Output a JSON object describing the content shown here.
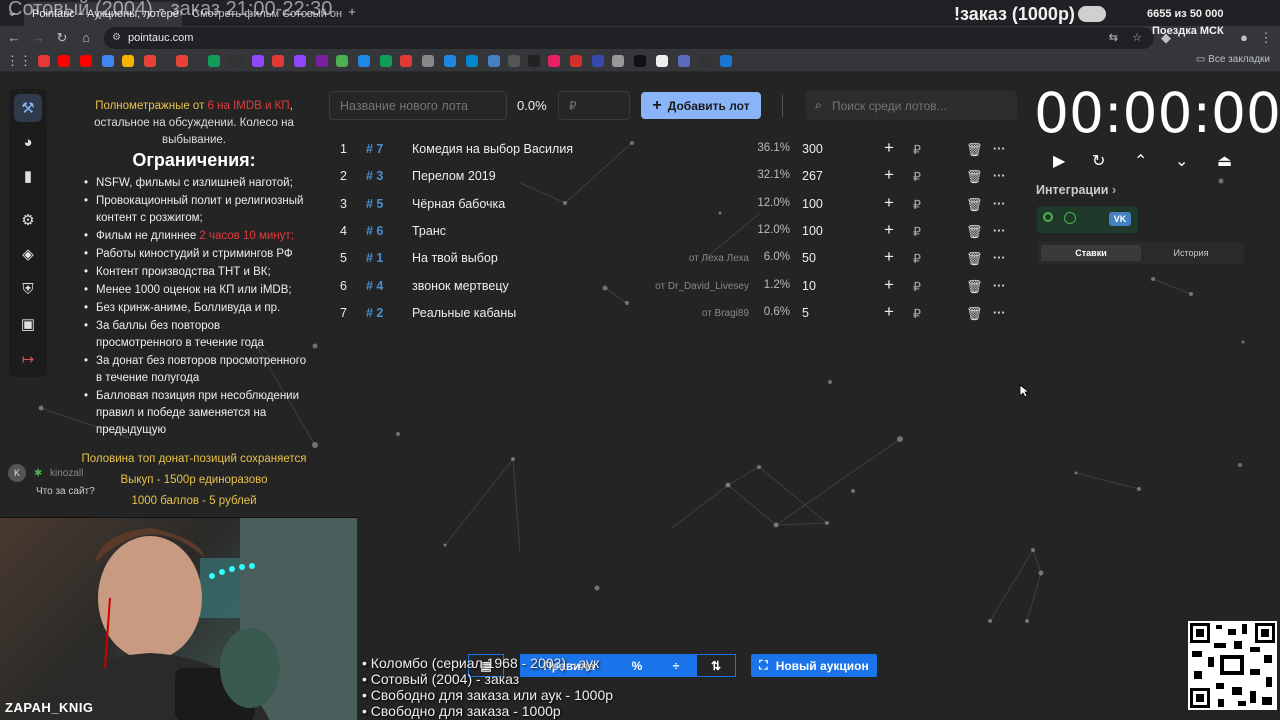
{
  "browser": {
    "tabs": [
      {
        "label": "Pointauc – Аукционы, лотере",
        "active": true
      },
      {
        "label": "Смотреть фильм Сотовый он",
        "active": false
      }
    ],
    "overlay_title": "Сотовый (2004) - заказ 21:00-22:30",
    "url": "pointauc.com",
    "bookmarks_all": "Все закладки"
  },
  "stream_overlay": {
    "order_label": "!заказ (1000р)",
    "goal": "6655  из 50 000",
    "trip": "Поездка МСК"
  },
  "rules": {
    "intro_pre": "Полнометражные от ",
    "intro_red": "6 на IMDB и КП",
    "intro_post": ", остальное на обсуждении. Колесо на выбывание.",
    "heading": "Ограничения:",
    "items": [
      "NSFW, фильмы с излишней наготой;",
      "Провокационный полит и религиозный контент с розжигом;",
      "Фильм не длиннее ",
      "Работы киностудий и стримингов РФ",
      "Контент производства ТНТ и ВК;",
      "Менее 1000 оценок на КП или iMDB;",
      "Без кринж-аниме, Болливуда и пр.",
      "За баллы без повторов просмотренного в течение года",
      "За донат без повторов просмотренного в течение полугода",
      "Балловая позиция при несоблюдении правил и победе заменяется на предыдущую"
    ],
    "duration_red": "2 часов 10 минут;",
    "footer": [
      "Половина топ донат-позиций сохраняется",
      "Выкуп - 1500р единоразово",
      "1000 баллов - 5 рублей"
    ]
  },
  "chat": {
    "user": "kinozall",
    "message": "Что за сайт?"
  },
  "lot_form": {
    "name_placeholder": "Название нового лота",
    "percent": "0.0%",
    "amount_placeholder": "₽",
    "add_label": "Добавить лот",
    "search_placeholder": "Поиск среди лотов..."
  },
  "lots": [
    {
      "idx": "1",
      "id": "# 7",
      "name": "Комедия на выбор Василия",
      "from": "",
      "pct": "36.1%",
      "value": "300"
    },
    {
      "idx": "2",
      "id": "# 3",
      "name": "Перелом 2019",
      "from": "",
      "pct": "32.1%",
      "value": "267"
    },
    {
      "idx": "3",
      "id": "# 5",
      "name": "Чёрная бабочка",
      "from": "",
      "pct": "12.0%",
      "value": "100"
    },
    {
      "idx": "4",
      "id": "# 6",
      "name": "Транс",
      "from": "",
      "pct": "12.0%",
      "value": "100"
    },
    {
      "idx": "5",
      "id": "# 1",
      "name": "На твой выбор",
      "from": "от Леха Леха",
      "pct": "6.0%",
      "value": "50"
    },
    {
      "idx": "6",
      "id": "# 4",
      "name": "звонок мертвецу",
      "from": "от Dr_David_Livesey",
      "pct": "1.2%",
      "value": "10"
    },
    {
      "idx": "7",
      "id": "# 2",
      "name": "Реальные кабаны",
      "from": "от Bragi89",
      "pct": "0.6%",
      "value": "5"
    }
  ],
  "lot_row_currency": "₽",
  "timer": {
    "value": "00:00:00"
  },
  "integrations": {
    "label": "Интеграции",
    "tabs": [
      "Ставки",
      "История"
    ]
  },
  "bottom_toolbar": {
    "rules_label": "Правила",
    "new_auction_label": "Новый аукцион"
  },
  "order_list": [
    "• Коломбо (сериал 1968 - 2003) - аук",
    "• Сотовый (2004) - заказ",
    "• Свободно для заказа или аук - 1000р",
    "• Свободно для заказа - 1000р"
  ],
  "streamer": {
    "name": "ZAPAH_KNIG"
  },
  "colors": {
    "accent": "#8ab4f8",
    "primary_button": "#1a73e8",
    "gold": "#e8c24a",
    "red": "#e23b3b",
    "lot_id": "#4a8fd0"
  }
}
